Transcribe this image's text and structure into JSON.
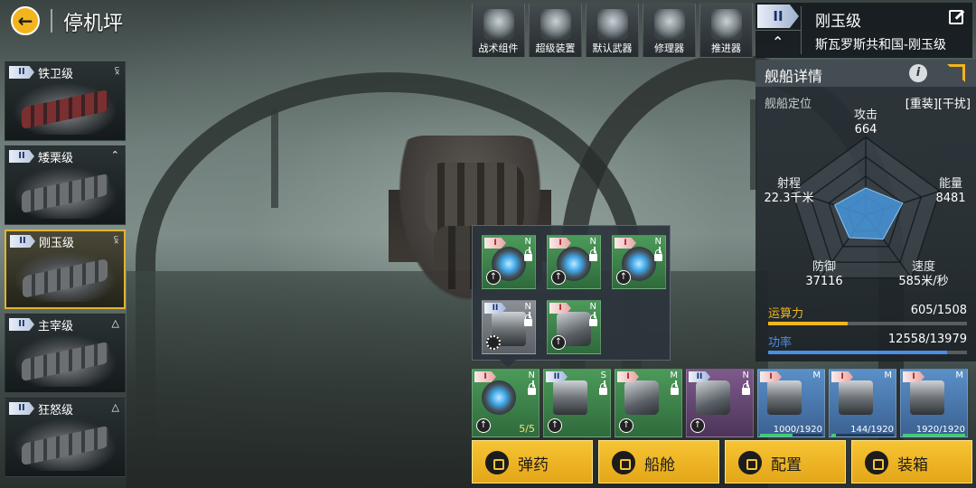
{
  "header": {
    "title": "停机坪",
    "back_icon": "back-arrow-icon"
  },
  "ships": [
    {
      "tier": "II",
      "name": "铁卫级",
      "rank_icon": "double-chevron-icon",
      "style": "red"
    },
    {
      "tier": "II",
      "name": "矮栗级",
      "rank_icon": "chevron-icon",
      "style": ""
    },
    {
      "tier": "II",
      "name": "刚玉级",
      "rank_icon": "double-chevron-icon",
      "style": "",
      "selected": true
    },
    {
      "tier": "II",
      "name": "主宰级",
      "rank_icon": "triangle-icon",
      "style": ""
    },
    {
      "tier": "II",
      "name": "狂怒级",
      "rank_icon": "triangle-icon",
      "style": ""
    }
  ],
  "categories": [
    {
      "label": "战术组件",
      "icon": "tactical-component-icon"
    },
    {
      "label": "超级装置",
      "icon": "super-device-icon"
    },
    {
      "label": "默认武器",
      "icon": "default-weapon-icon"
    },
    {
      "label": "修理器",
      "icon": "repair-icon"
    },
    {
      "label": "推进器",
      "icon": "thruster-icon"
    }
  ],
  "ship_info": {
    "tier": "II",
    "name": "刚玉级",
    "class": "斯瓦罗斯共和国-刚玉级"
  },
  "detail": {
    "title": "舰船详情",
    "role_label": "舰船定位",
    "role_value": "[重装][干扰]",
    "stats": {
      "attack_label": "攻击",
      "attack": "664",
      "energy_label": "能量",
      "energy": "8481",
      "speed_label": "速度",
      "speed": "585米/秒",
      "defense_label": "防御",
      "defense": "37116",
      "range_label": "射程",
      "range": "22.3千米"
    },
    "radar_values": [
      0.35,
      0.5,
      0.38,
      0.36,
      0.42
    ],
    "compute": {
      "label": "运算力",
      "value": "605/1508",
      "fraction": 0.4,
      "color": "#f2b51c"
    },
    "power": {
      "label": "功率",
      "value": "12558/13979",
      "fraction": 0.9,
      "color": "#4a8ee6"
    }
  },
  "popup_modules": [
    {
      "tier": "I",
      "letter": "N",
      "color": "green",
      "art": "reactor"
    },
    {
      "tier": "I",
      "letter": "N",
      "color": "green",
      "art": "reactor"
    },
    {
      "tier": "I",
      "letter": "N",
      "color": "green",
      "art": "reactor"
    },
    {
      "tier": "II",
      "letter": "N",
      "color": "gray",
      "art": "turret",
      "gear": true
    },
    {
      "tier": "I",
      "letter": "N",
      "color": "green",
      "art": "device"
    }
  ],
  "bottom_modules": [
    {
      "tier": "I",
      "letter": "N",
      "color": "green",
      "art": "reactor",
      "count": "5/5"
    },
    {
      "tier": "II",
      "letter": "S",
      "color": "green",
      "art": "turret"
    },
    {
      "tier": "I",
      "letter": "M",
      "color": "green",
      "art": "device"
    },
    {
      "tier": "II",
      "letter": "N",
      "color": "purple",
      "art": "device"
    },
    {
      "tier": "I",
      "letter": "M",
      "color": "blue",
      "art": "turret",
      "progress": "1000/1920",
      "fraction": 0.52
    },
    {
      "tier": "I",
      "letter": "M",
      "color": "blue",
      "art": "turret",
      "progress": "144/1920",
      "fraction": 0.075
    },
    {
      "tier": "I",
      "letter": "M",
      "color": "blue",
      "art": "turret",
      "progress": "1920/1920",
      "fraction": 1.0
    }
  ],
  "actions": [
    {
      "label": "弹药",
      "icon": "ammo-icon"
    },
    {
      "label": "船舱",
      "icon": "cabin-icon"
    },
    {
      "label": "配置",
      "icon": "config-icon"
    },
    {
      "label": "装箱",
      "icon": "crate-icon"
    }
  ]
}
